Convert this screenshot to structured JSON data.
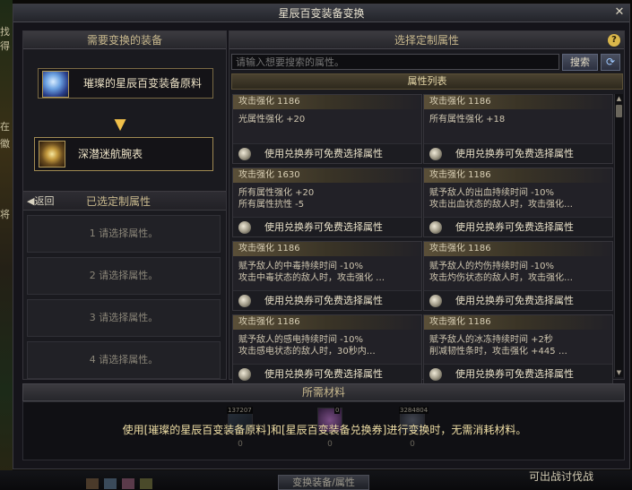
{
  "window": {
    "title": "星辰百变装备变换",
    "close_label": "✕"
  },
  "left": {
    "header": "需要变换的装备",
    "material_slot": {
      "label": "璀璨的星辰百变装备原料",
      "icon": "material-crystal-icon"
    },
    "target_slot": {
      "label": "深潜迷航腕表",
      "icon": "wristwatch-icon"
    },
    "arrow": "▼",
    "back_label": "◀返回",
    "selected_header": "已选定制属性",
    "selection_rows": [
      "1 请选择属性。",
      "2 请选择属性。",
      "3 请选择属性。",
      "4 请选择属性。"
    ]
  },
  "right": {
    "header": "选择定制属性",
    "help_label": "?",
    "search": {
      "placeholder": "请输入想要搜索的属性。",
      "button": "搜索",
      "refresh": "⟳"
    },
    "list_header": "属性列表",
    "coupon_text": "使用兑换券可免费选择属性",
    "cards": [
      {
        "title": "攻击强化 1186",
        "lines": [
          "光属性强化 +20"
        ]
      },
      {
        "title": "攻击强化 1186",
        "lines": [
          "所有属性强化 +18"
        ]
      },
      {
        "title": "攻击强化 1630",
        "lines": [
          "所有属性强化 +20",
          "所有属性抗性 -5"
        ]
      },
      {
        "title": "攻击强化 1186",
        "lines": [
          "赋予敌人的出血持续时间 -10%",
          "攻击出血状态的敌人时，攻击强化…"
        ]
      },
      {
        "title": "攻击强化 1186",
        "lines": [
          "赋予敌人的中毒持续时间 -10%",
          "攻击中毒状态的敌人时，攻击强化 …"
        ]
      },
      {
        "title": "攻击强化 1186",
        "lines": [
          "赋予敌人的灼伤持续时间 -10%",
          "攻击灼伤状态的敌人时，攻击强化…"
        ]
      },
      {
        "title": "攻击强化 1186",
        "lines": [
          "赋予敌人的感电持续时间 -10%",
          "攻击感电状态的敌人时，30秒内…"
        ]
      },
      {
        "title": "攻击强化 1186",
        "lines": [
          "赋予敌人的冰冻持续时间 +2秒",
          "削减韧性条时，攻击强化 +445 …"
        ]
      }
    ]
  },
  "materials": {
    "header": "所需材料",
    "items": [
      {
        "badge": "137207",
        "count": "0",
        "icon": "coupon-box-icon"
      },
      {
        "badge": "0",
        "count": "0",
        "icon": "material-crystal-icon"
      },
      {
        "badge": "3284804",
        "count": "0",
        "icon": "gold-coin-icon"
      }
    ],
    "notice": "使用[璀璨的星辰百变装备原料]和[星辰百变装备兑换券]进行变换时，无需消耗材料。"
  },
  "bottom": {
    "convert_button": "变换装备/属性",
    "right_text": "可出战讨伐战"
  },
  "background": {
    "left_chars": [
      "找",
      "得",
      "在",
      "徽",
      "将"
    ]
  },
  "colors": {
    "accent_gold": "#c9b98e",
    "notice": "#f0dfa6",
    "frame": "#15141a"
  }
}
